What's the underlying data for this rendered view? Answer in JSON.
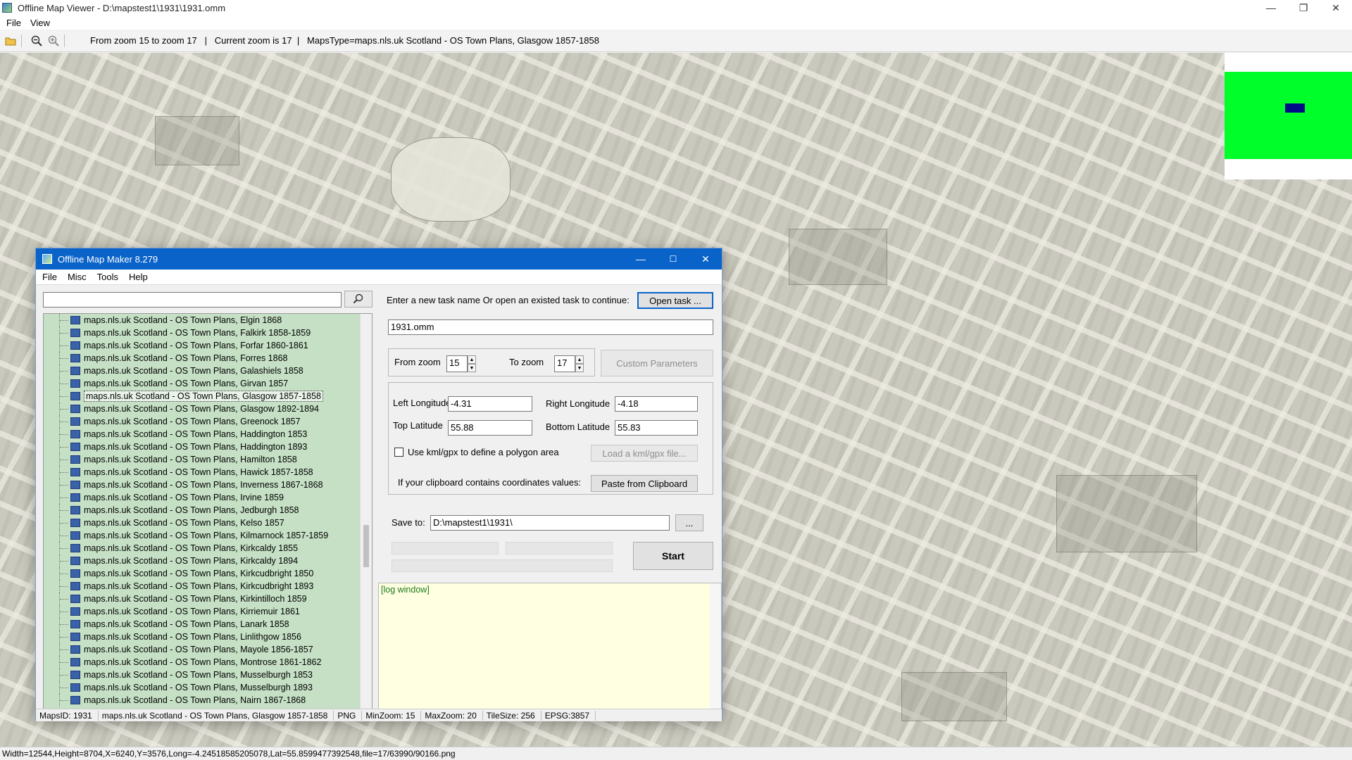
{
  "window": {
    "title": "Offline Map Viewer - D:\\mapstest1\\1931\\1931.omm",
    "controls": {
      "minimize": "—",
      "restore": "❐",
      "close": "✕"
    }
  },
  "menubar": {
    "file": "File",
    "view": "View"
  },
  "toolbar": {
    "info": "From zoom 15 to zoom 17   |   Current zoom is 17  |   MapsType=maps.nls.uk Scotland - OS Town Plans, Glasgow 1857-1858"
  },
  "statusbar": {
    "text": "Width=12544,Height=8704,X=6240,Y=3576,Long=-4.24518585205078,Lat=55.8599477392548,file=17/63990/90166.png"
  },
  "dialog": {
    "title": "Offline Map Maker 8.279",
    "menu": {
      "file": "File",
      "misc": "Misc",
      "tools": "Tools",
      "help": "Help"
    },
    "search": {
      "value": "",
      "icon": "search-icon"
    },
    "maplist": [
      "maps.nls.uk Scotland - OS Town Plans, Elgin 1868",
      "maps.nls.uk Scotland - OS Town Plans, Falkirk 1858-1859",
      "maps.nls.uk Scotland - OS Town Plans, Forfar 1860-1861",
      "maps.nls.uk Scotland - OS Town Plans, Forres 1868",
      "maps.nls.uk Scotland - OS Town Plans, Galashiels 1858",
      "maps.nls.uk Scotland - OS Town Plans, Girvan 1857",
      "maps.nls.uk Scotland - OS Town Plans, Glasgow 1857-1858",
      "maps.nls.uk Scotland - OS Town Plans, Glasgow 1892-1894",
      "maps.nls.uk Scotland - OS Town Plans, Greenock 1857",
      "maps.nls.uk Scotland - OS Town Plans, Haddington 1853",
      "maps.nls.uk Scotland - OS Town Plans, Haddington 1893",
      "maps.nls.uk Scotland - OS Town Plans, Hamilton 1858",
      "maps.nls.uk Scotland - OS Town Plans, Hawick 1857-1858",
      "maps.nls.uk Scotland - OS Town Plans, Inverness 1867-1868",
      "maps.nls.uk Scotland - OS Town Plans, Irvine 1859",
      "maps.nls.uk Scotland - OS Town Plans, Jedburgh 1858",
      "maps.nls.uk Scotland - OS Town Plans, Kelso 1857",
      "maps.nls.uk Scotland - OS Town Plans, Kilmarnock 1857-1859",
      "maps.nls.uk Scotland - OS Town Plans, Kirkcaldy 1855",
      "maps.nls.uk Scotland - OS Town Plans, Kirkcaldy 1894",
      "maps.nls.uk Scotland - OS Town Plans, Kirkcudbright 1850",
      "maps.nls.uk Scotland - OS Town Plans, Kirkcudbright 1893",
      "maps.nls.uk Scotland - OS Town Plans, Kirkintilloch 1859",
      "maps.nls.uk Scotland - OS Town Plans, Kirriemuir 1861",
      "maps.nls.uk Scotland - OS Town Plans, Lanark 1858",
      "maps.nls.uk Scotland - OS Town Plans, Linlithgow 1856",
      "maps.nls.uk Scotland - OS Town Plans, Mayole 1856-1857",
      "maps.nls.uk Scotland - OS Town Plans, Montrose 1861-1862",
      "maps.nls.uk Scotland - OS Town Plans, Musselburgh 1853",
      "maps.nls.uk Scotland - OS Town Plans, Musselburgh 1893",
      "maps.nls.uk Scotland - OS Town Plans, Nairn 1867-1868"
    ],
    "selected_index": 6,
    "task_prompt": "Enter a new task name Or open an existed task to continue:",
    "open_task_label": "Open task ...",
    "task_name": "1931.omm",
    "from_zoom_label": "From zoom",
    "from_zoom": "15",
    "to_zoom_label": "To zoom",
    "to_zoom": "17",
    "custom_params_label": "Custom Parameters",
    "left_lon_label": "Left Longitude",
    "left_lon": "-4.31",
    "right_lon_label": "Right Longitude",
    "right_lon": "-4.18",
    "top_lat_label": "Top Latitude",
    "top_lat": "55.88",
    "bottom_lat_label": "Bottom Latitude",
    "bottom_lat": "55.83",
    "kml_label": "Use kml/gpx to define a polygon area",
    "load_kml_label": "Load a kml/gpx file...",
    "clipboard_label": "If your clipboard contains coordinates values:",
    "paste_label": "Paste from Clipboard",
    "save_to_label": "Save to:",
    "save_to": "D:\\mapstest1\\1931\\",
    "browse_label": "...",
    "start_label": "Start",
    "log_text": "[log window]",
    "status": {
      "maps_id": "MapsID: 1931",
      "map_name": "maps.nls.uk Scotland - OS Town Plans, Glasgow 1857-1858",
      "format": "PNG",
      "min_zoom": "MinZoom: 15",
      "max_zoom": "MaxZoom: 20",
      "tile_size": "TileSize: 256",
      "epsg": "EPSG:3857"
    }
  }
}
